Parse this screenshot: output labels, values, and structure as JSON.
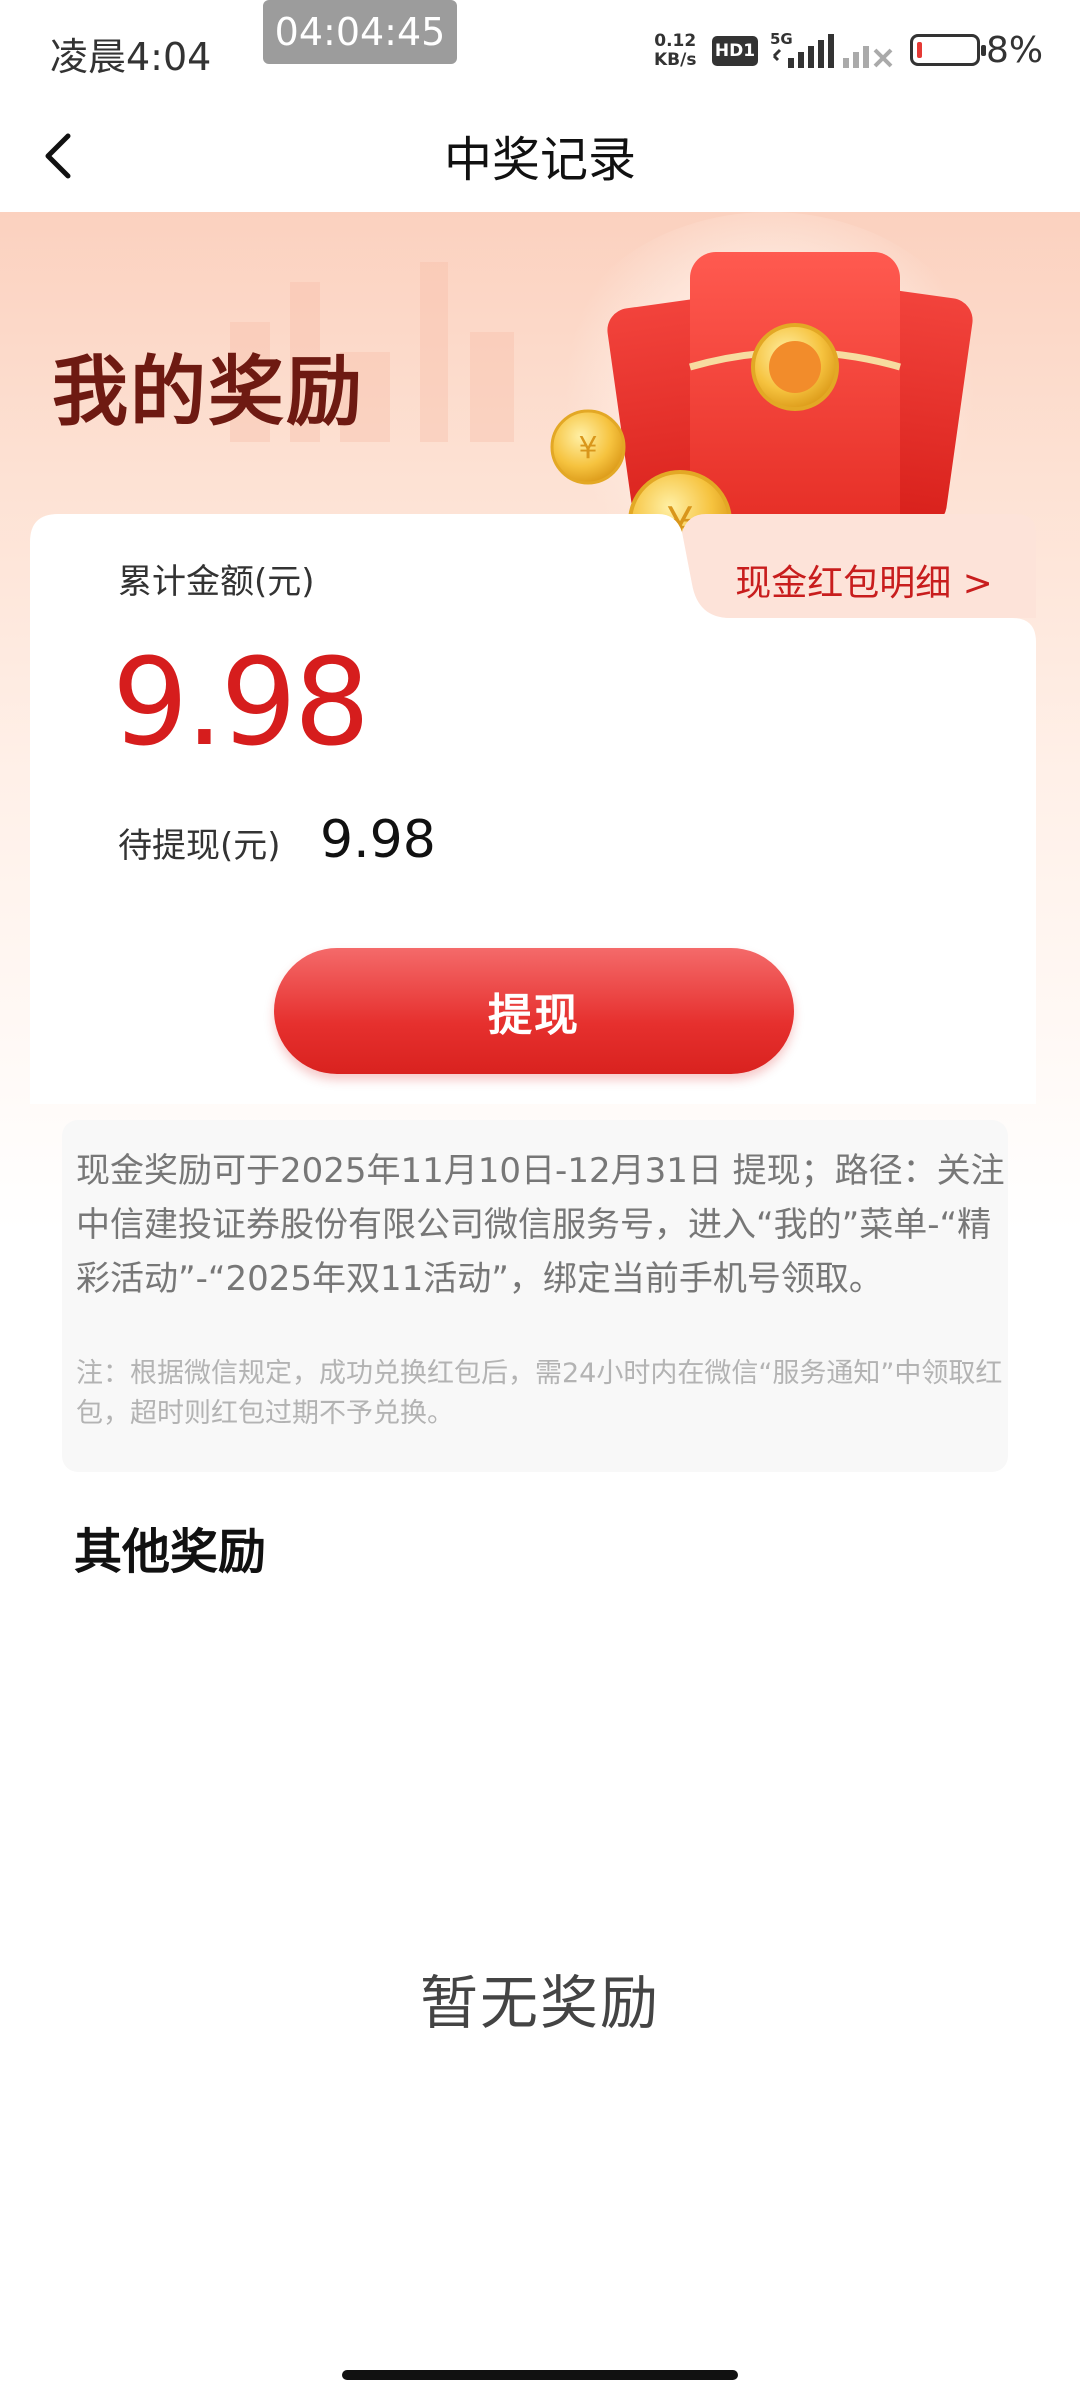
{
  "status_bar": {
    "time": "凌晨4:04",
    "recording_time": "04:04:45",
    "net_speed_value": "0.12",
    "net_speed_unit": "KB/s",
    "hd_label": "HD1",
    "signal_label": "5G",
    "battery_percent": "8%"
  },
  "nav": {
    "title": "中奖记录",
    "back_icon": "chevron-left-icon"
  },
  "hero": {
    "title": "我的奖励"
  },
  "rewards": {
    "total_label": "累计金额(元)",
    "total_amount": "9.98",
    "pending_label": "待提现(元)",
    "pending_amount": "9.98",
    "detail_link": "现金红包明细 >",
    "withdraw_button": "提现"
  },
  "notice": {
    "main": "现金奖励可于2025年11月10日-12月31日 提现；路径：关注中信建投证券股份有限公司微信服务号，进入“我的”菜单-“精彩活动”-“2025年双11活动”，绑定当前手机号领取。",
    "note": "注：根据微信规定，成功兑换红包后，需24小时内在微信“服务通知”中领取红包，超时则红包过期不予兑换。"
  },
  "other_rewards": {
    "title": "其他奖励",
    "empty_text": "暂无奖励"
  },
  "colors": {
    "accent_red": "#d61d1d",
    "button_red": "#e6302e",
    "hero_title": "#6e1a12"
  }
}
